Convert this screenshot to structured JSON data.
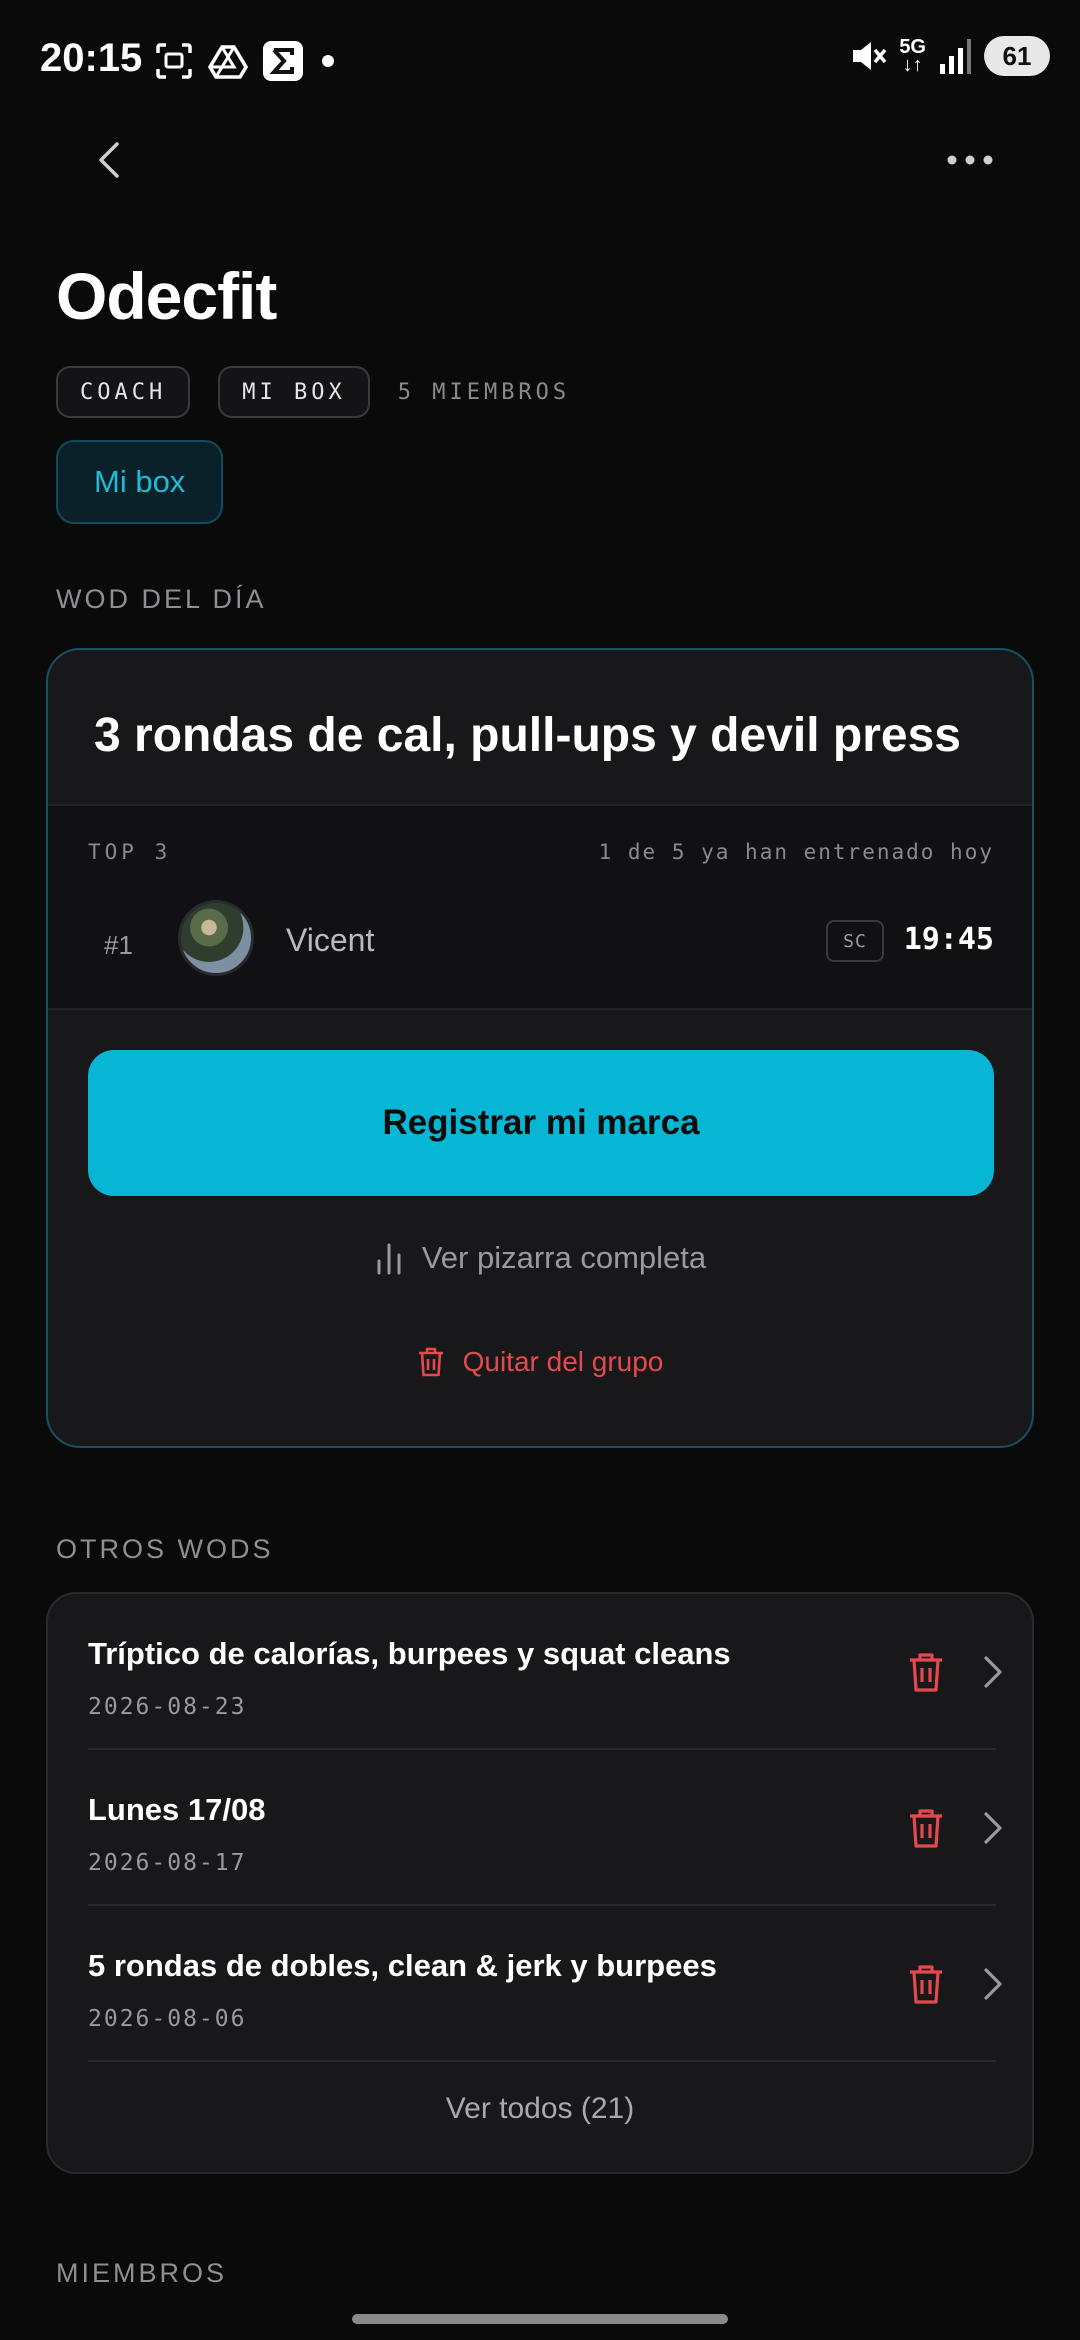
{
  "status_bar": {
    "time": "20:15",
    "network": "5G",
    "battery": "61"
  },
  "header": {
    "title": "Odecfit",
    "badges": [
      "COACH",
      "MI BOX"
    ],
    "members_count": "5 MIEMBROS",
    "group_tab": "Mi box"
  },
  "wod_section": {
    "label": "WOD DEL DÍA",
    "title": "3 rondas de cal, pull-ups y devil press",
    "top3_label": "TOP 3",
    "trained_status": "1 de 5 ya han entrenado hoy",
    "leaderboard": [
      {
        "rank": "#1",
        "name": "Vicent",
        "badge": "SC",
        "time": "19:45"
      }
    ],
    "cta_label": "Registrar mi marca",
    "board_link": "Ver pizarra completa",
    "remove_link": "Quitar del grupo"
  },
  "others_section": {
    "label": "OTROS WODS",
    "items": [
      {
        "title": "Tríptico de calorías, burpees y squat cleans",
        "date": "2026-08-23"
      },
      {
        "title": "Lunes 17/08",
        "date": "2026-08-17"
      },
      {
        "title": "5 rondas de dobles, clean & jerk y burpees",
        "date": "2026-08-06"
      }
    ],
    "see_all": "Ver todos (21)"
  },
  "members_section": {
    "label": "MIEMBROS"
  },
  "colors": {
    "accent": "#06b6d4",
    "danger": "#e5484d",
    "background": "#0a0a0b",
    "card": "#18181a"
  }
}
